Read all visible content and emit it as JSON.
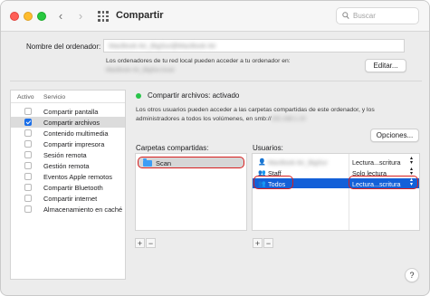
{
  "window": {
    "title": "Compartir"
  },
  "toolbar": {
    "back_icon": "chevron-left-icon",
    "forward_icon": "chevron-right-icon",
    "grid_icon": "grid-icon",
    "search_placeholder": "Buscar"
  },
  "computer_name": {
    "label": "Nombre del ordenador:",
    "value_redacted": "MacBook Air_BigSur@MacBook Air",
    "description": "Los ordenadores de tu red local pueden acceder a tu ordenador en:",
    "address_redacted": "MacBook-Air_BigSur.local",
    "edit_button": "Editar..."
  },
  "services": {
    "col_active": "Activo",
    "col_service": "Servicio",
    "items": [
      {
        "label": "Compartir pantalla",
        "checked": false,
        "selected": false
      },
      {
        "label": "Compartir archivos",
        "checked": true,
        "selected": true
      },
      {
        "label": "Contenido multimedia",
        "checked": false,
        "selected": false
      },
      {
        "label": "Compartir impresora",
        "checked": false,
        "selected": false
      },
      {
        "label": "Sesión remota",
        "checked": false,
        "selected": false
      },
      {
        "label": "Gestión remota",
        "checked": false,
        "selected": false
      },
      {
        "label": "Eventos Apple remotos",
        "checked": false,
        "selected": false
      },
      {
        "label": "Compartir Bluetooth",
        "checked": false,
        "selected": false
      },
      {
        "label": "Compartir internet",
        "checked": false,
        "selected": false
      },
      {
        "label": "Almacenamiento en caché",
        "checked": false,
        "selected": false
      }
    ]
  },
  "status": {
    "text": "Compartir archivos: activado",
    "color": "#29c44a",
    "description": "Los otros usuarios pueden acceder a las carpetas compartidas de este ordenador, y los administradores a todos los volúmenes, en smb://",
    "address_redacted": "192.168.1.10",
    "options_button": "Opciones..."
  },
  "shared_folders": {
    "label": "Carpetas compartidas:",
    "items": [
      {
        "name": "Scan",
        "icon": "folder-icon"
      }
    ],
    "add": "+",
    "remove": "−"
  },
  "users": {
    "label": "Usuarios:",
    "rows": [
      {
        "name_redacted": "MacBook Air_BigSur",
        "icon": "user-icon",
        "permission": "Lectura...scritura",
        "selected": false
      },
      {
        "name": "Staff",
        "icon": "group-icon",
        "permission": "Solo lectura",
        "selected": false
      },
      {
        "name": "Todos",
        "icon": "group-icon",
        "permission": "Lectura...scritura",
        "selected": true
      }
    ],
    "add": "+",
    "remove": "−"
  },
  "help_button": "?",
  "colors": {
    "accent": "#1360d8",
    "highlight": "#d81e1e"
  }
}
